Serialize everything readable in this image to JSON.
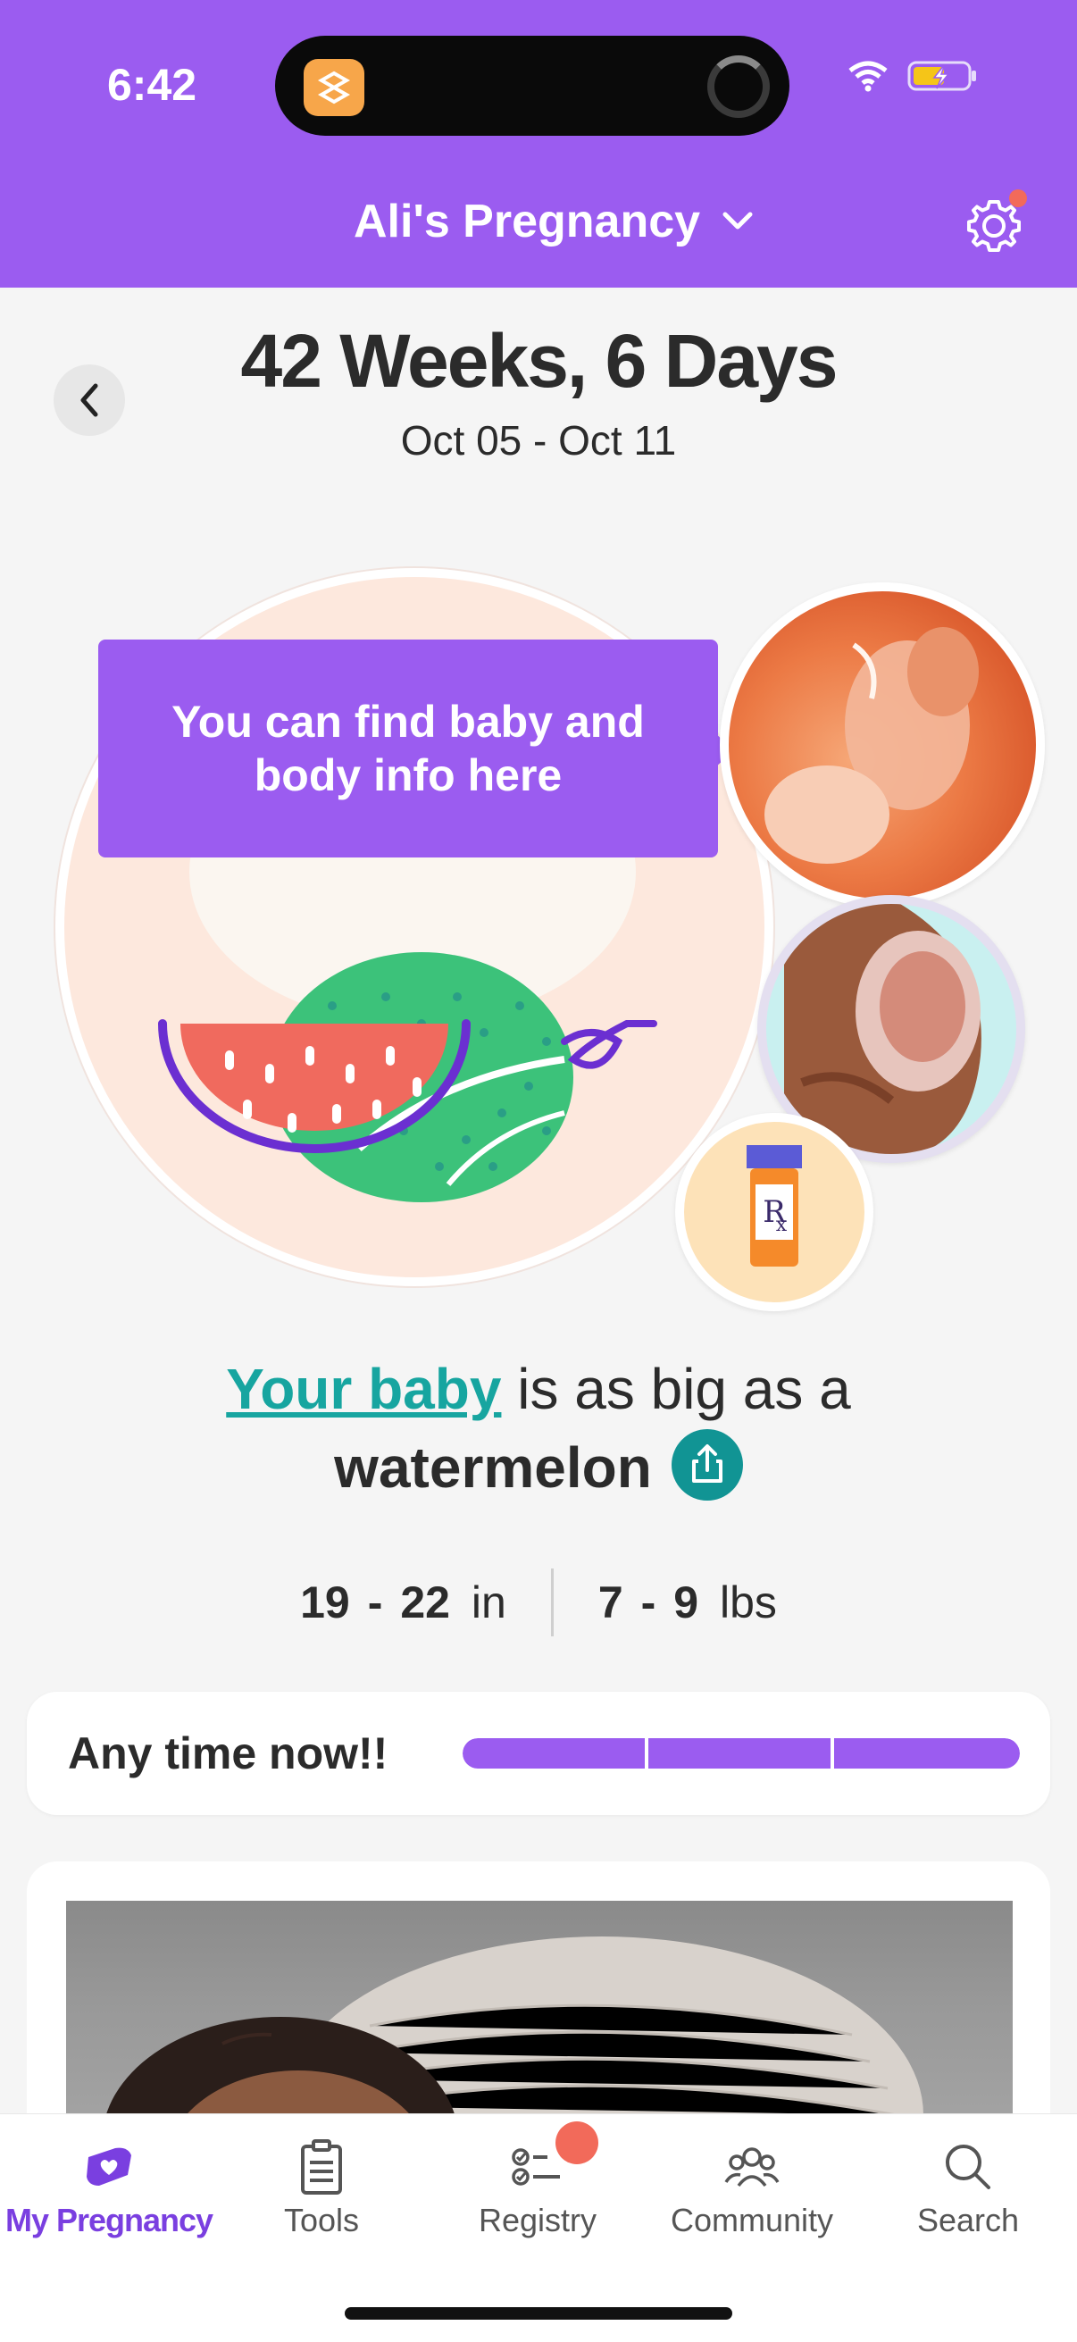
{
  "status_bar": {
    "time": "6:42"
  },
  "header": {
    "title": "Ali's Pregnancy"
  },
  "week": {
    "title": "42 Weeks, 6 Days",
    "date_range": "Oct 05 - Oct 11"
  },
  "tooltip": {
    "text": "You can find baby and body info here"
  },
  "size": {
    "link_text": "Your baby",
    "compare_text": " is as big as a",
    "fruit": "watermelon"
  },
  "measurements": {
    "length_min": "19",
    "length_max": "22",
    "length_unit": "in",
    "weight_min": "7",
    "weight_max": "9",
    "weight_unit": "lbs",
    "range_sep": "-"
  },
  "progress": {
    "label": "Any time now!!",
    "fraction": 1.0
  },
  "colors": {
    "accent": "#9b5cf0",
    "teal": "#17a5a0",
    "badge": "#f26a5a"
  },
  "nav": [
    {
      "label": "My Pregnancy",
      "icon": "pregnancy-heart-icon",
      "active": true
    },
    {
      "label": "Tools",
      "icon": "clipboard-icon",
      "active": false
    },
    {
      "label": "Registry",
      "icon": "checklist-icon",
      "active": false
    },
    {
      "label": "Community",
      "icon": "community-icon",
      "active": false
    },
    {
      "label": "Search",
      "icon": "search-icon",
      "active": false
    }
  ]
}
